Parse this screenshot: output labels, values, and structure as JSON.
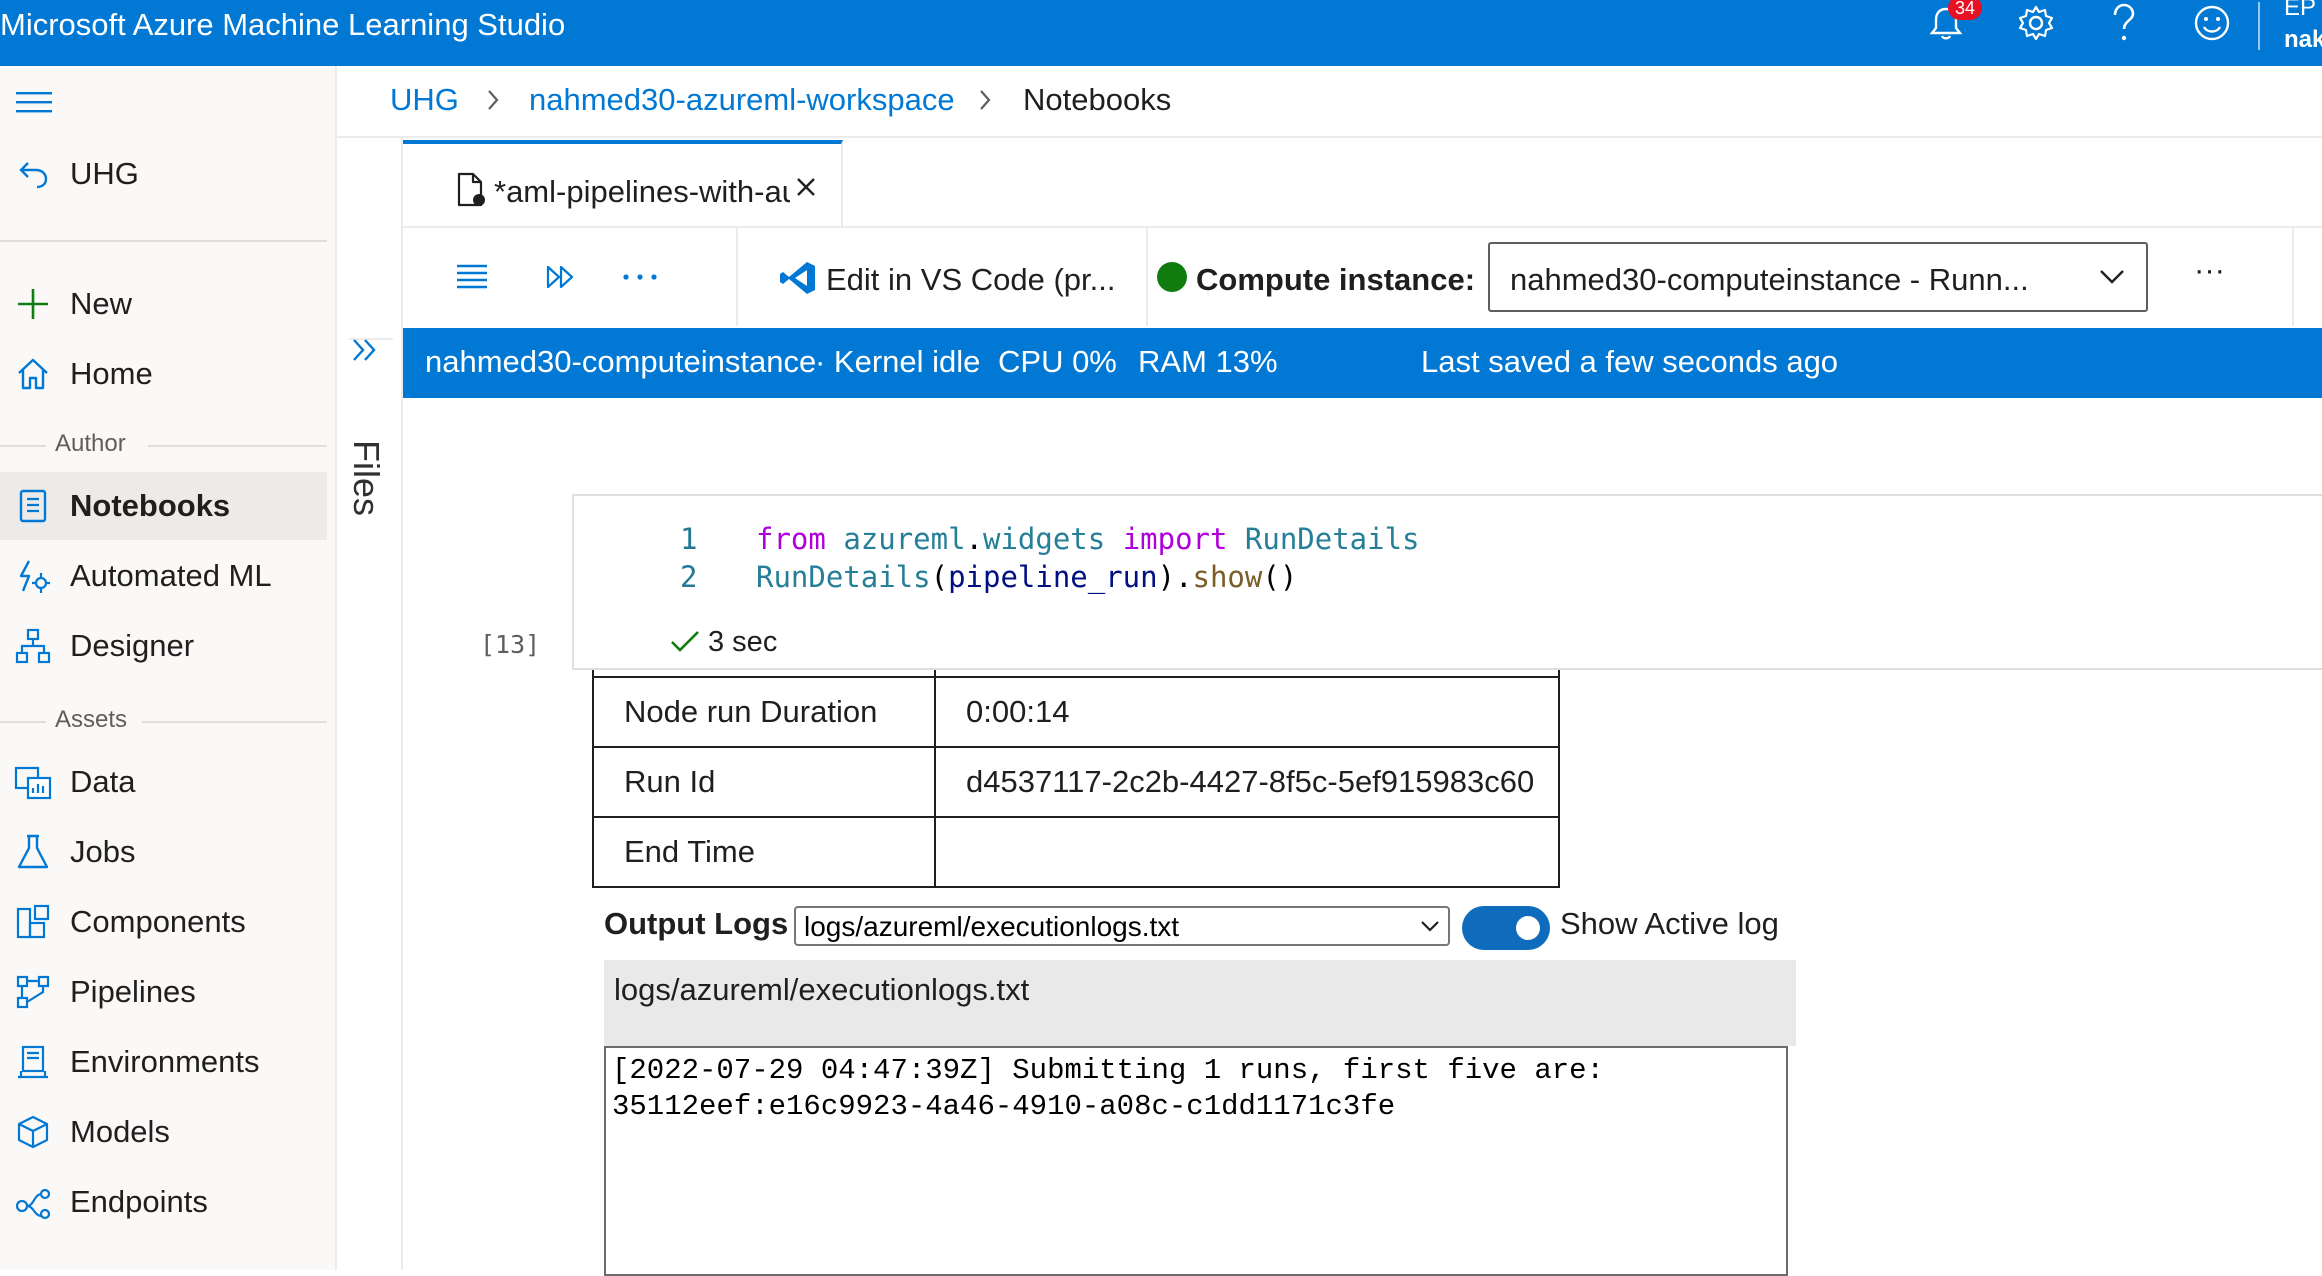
{
  "app": {
    "title": "Microsoft Azure Machine Learning Studio",
    "notification_count": "34",
    "user_line1": "EP",
    "user_line2": "nak",
    "accent_color": "#0078d4"
  },
  "nav": {
    "back_label": "UHG",
    "items_top": [
      {
        "label": "New",
        "icon": "plus-icon"
      },
      {
        "label": "Home",
        "icon": "home-icon"
      }
    ],
    "section_author": "Author",
    "items_author": [
      {
        "label": "Notebooks",
        "icon": "notebook-icon",
        "selected": true
      },
      {
        "label": "Automated ML",
        "icon": "automl-icon"
      },
      {
        "label": "Designer",
        "icon": "designer-icon"
      }
    ],
    "section_assets": "Assets",
    "items_assets": [
      {
        "label": "Data",
        "icon": "data-icon"
      },
      {
        "label": "Jobs",
        "icon": "flask-icon"
      },
      {
        "label": "Components",
        "icon": "components-icon"
      },
      {
        "label": "Pipelines",
        "icon": "pipelines-icon"
      },
      {
        "label": "Environments",
        "icon": "environments-icon"
      },
      {
        "label": "Models",
        "icon": "cube-icon"
      },
      {
        "label": "Endpoints",
        "icon": "endpoints-icon"
      }
    ]
  },
  "breadcrumb": {
    "items": [
      "UHG",
      "nahmed30-azureml-workspace",
      "Notebooks"
    ]
  },
  "files_pane": {
    "label": "Files"
  },
  "tab": {
    "label": "*aml-pipelines-with-automated-machine-learning-step.ipynb"
  },
  "toolbar": {
    "edit_vscode": "Edit in VS Code (pr...",
    "compute_label": "Compute instance:",
    "compute_value": "nahmed30-computeinstance    -    Runn...",
    "compute_status_color": "#107c10",
    "more": "···"
  },
  "status": {
    "instance": "nahmed30-computeinstance",
    "kernel": "· Kernel idle",
    "cpu": "CPU  0%",
    "ram": "RAM 13%",
    "saved": "Last saved a few seconds ago"
  },
  "cell": {
    "execution_count": "[13]",
    "line_numbers": [
      "1",
      "2"
    ],
    "exec_time": "3 sec"
  },
  "output_table": {
    "rows": [
      {
        "key": "Node run Duration",
        "value": "0:00:14"
      },
      {
        "key": "Run Id",
        "value": "d4537117-2c2b-4427-8f5c-5ef915983c60"
      },
      {
        "key": "End Time",
        "value": ""
      }
    ]
  },
  "logs": {
    "label": "Output Logs",
    "selected_file": "logs/azureml/executionlogs.txt",
    "show_active_label": "Show Active log",
    "show_active_on": true,
    "header": "logs/azureml/executionlogs.txt",
    "lines": [
      "[2022-07-29 04:47:39Z] Submitting 1 runs, first five are:",
      "35112eef:e16c9923-4a46-4910-a08c-c1dd1171c3fe"
    ]
  }
}
